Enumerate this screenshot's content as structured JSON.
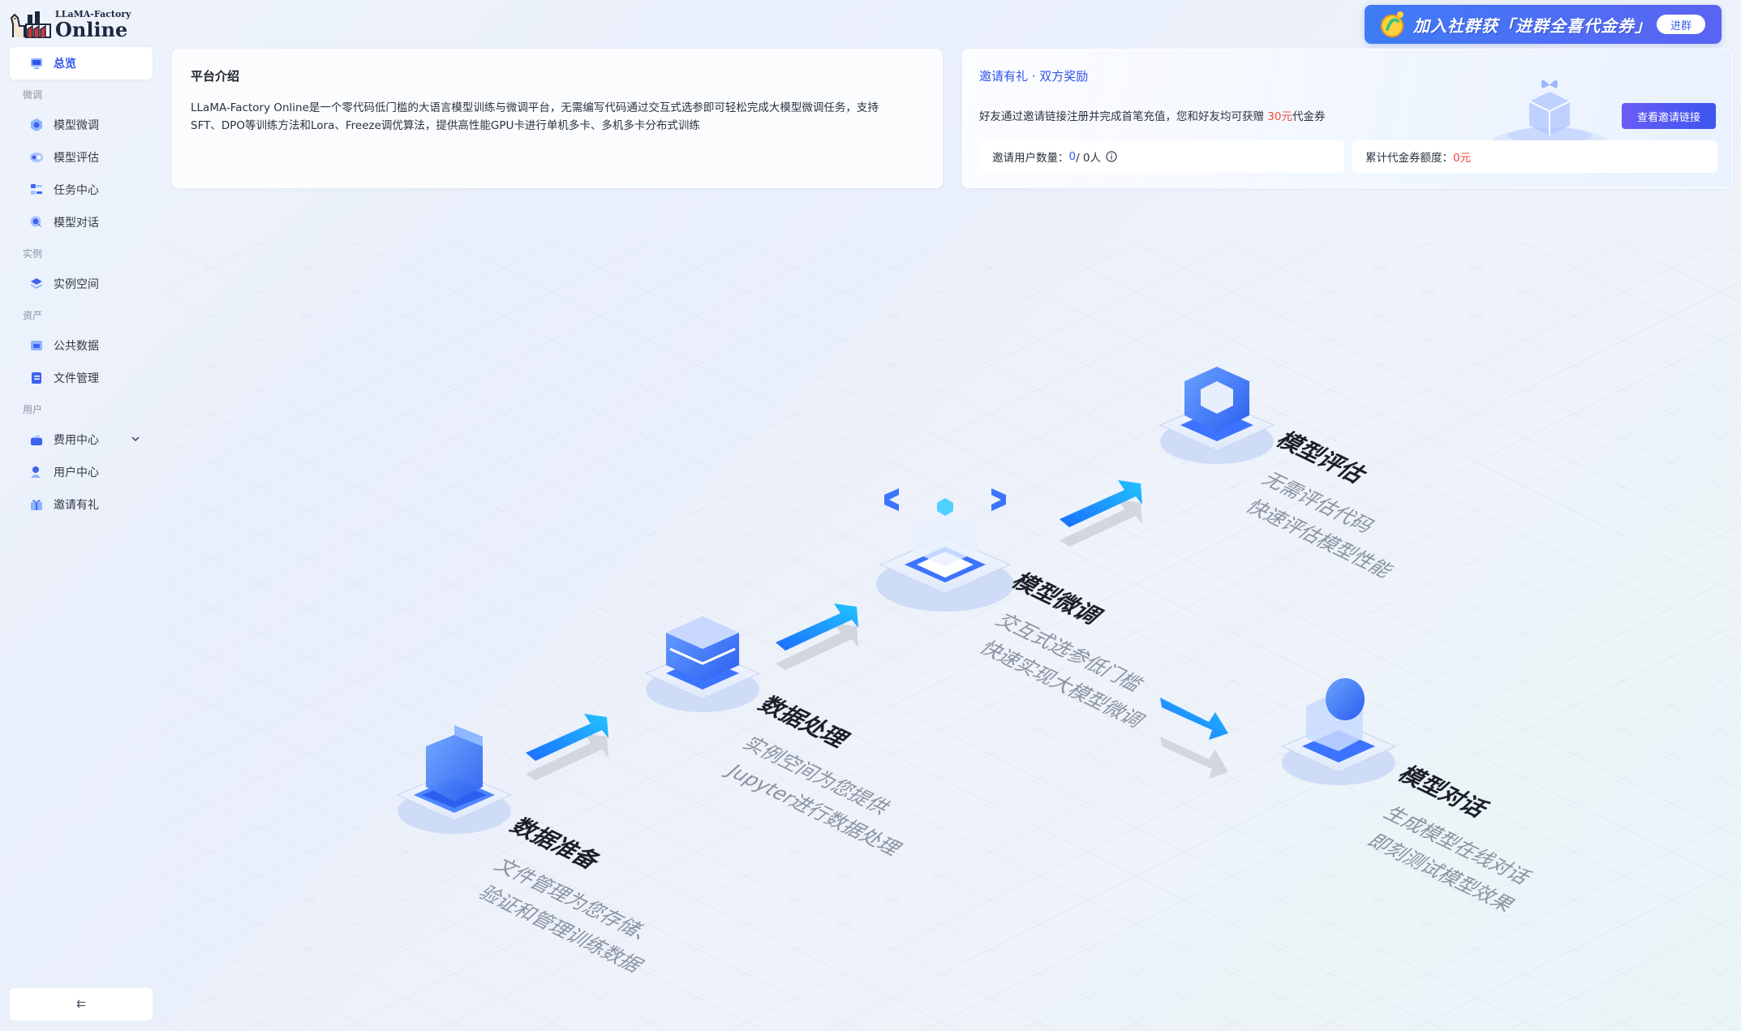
{
  "logo": {
    "sub": "LLaMA-Factory",
    "main": "Online"
  },
  "nav": {
    "overview": "总览",
    "group_finetune": "微调",
    "model_finetune": "模型微调",
    "model_eval": "模型评估",
    "task_center": "任务中心",
    "model_chat": "模型对话",
    "group_instance": "实例",
    "instance_space": "实例空间",
    "group_assets": "资产",
    "public_data": "公共数据",
    "file_mgmt": "文件管理",
    "group_user": "用户",
    "billing_center": "费用中心",
    "user_center": "用户中心",
    "invite": "邀请有礼",
    "collapse": "⇇"
  },
  "banner": {
    "text": "加入社群获「进群全喜代金券」",
    "button": "进群"
  },
  "intro": {
    "title": "平台介绍",
    "text": "LLaMA-Factory Online是一个零代码低门槛的大语言模型训练与微调平台，无需编写代码通过交互式选参即可轻松完成大模型微调任务，支持SFT、DPO等训练方法和Lora、Freeze调优算法，提供高性能GPU卡进行单机多卡、多机多卡分布式训练"
  },
  "invite": {
    "title": "邀请有礼 · 双方奖励",
    "desc_prefix": "好友通过邀请链接注册并完成首笔充值，您和好友均可获赠 ",
    "desc_amount": "30元",
    "desc_suffix": "代金券",
    "button": "查看邀请链接",
    "users_label": "邀请用户数量：",
    "users_value": "0",
    "users_total": "/ 0人",
    "credit_label": "累计代金券额度：",
    "credit_value": "0元"
  },
  "flow": {
    "steps": [
      {
        "title": "数据准备",
        "line1": "文件管理为您存储、",
        "line2": "验证和管理训练数据"
      },
      {
        "title": "数据处理",
        "line1": "实例空间为您提供",
        "line2": "Jupyter进行数据处理"
      },
      {
        "title": "模型微调",
        "line1": "交互式选参低门槛",
        "line2": "快速实现大模型微调"
      },
      {
        "title": "模型评估",
        "line1": "无需评估代码",
        "line2": "快速评估模型性能"
      },
      {
        "title": "模型对话",
        "line1": "生成模型在线对话",
        "line2": "即刻测试模型效果"
      }
    ]
  },
  "colors": {
    "primary": "#2f54eb",
    "accent_red": "#f5483b",
    "banner": "#4d6ff5"
  }
}
